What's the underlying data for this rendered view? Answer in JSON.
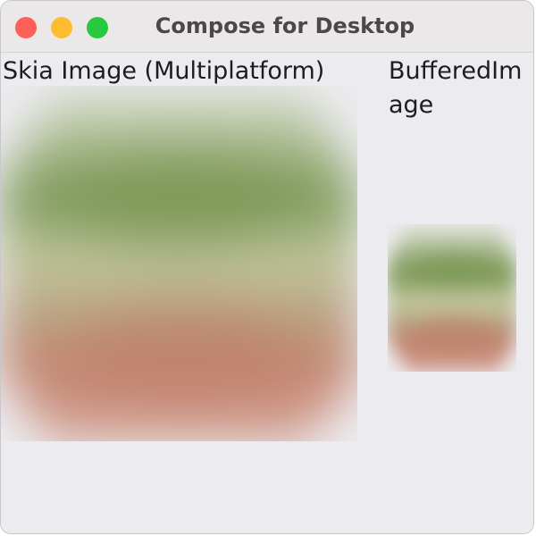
{
  "window": {
    "title": "Compose for Desktop"
  },
  "controls": {
    "close_color": "#fe5f57",
    "minimize_color": "#febc2e",
    "maximize_color": "#28c840"
  },
  "labels": {
    "skia": "Skia Image (Multiplatform)",
    "buffered": "BufferedImage"
  },
  "images": {
    "skia": {
      "icon": "blurred-photo-image",
      "top_color": "#7e9a5a",
      "bottom_color": "#d4a091"
    },
    "buffered": {
      "icon": "blurred-photo-image",
      "top_color": "#7d9a58",
      "bottom_color": "#d09f8e"
    }
  },
  "colors": {
    "window_background": "#ecebef",
    "titlebar_background": "#ebe8ea"
  }
}
